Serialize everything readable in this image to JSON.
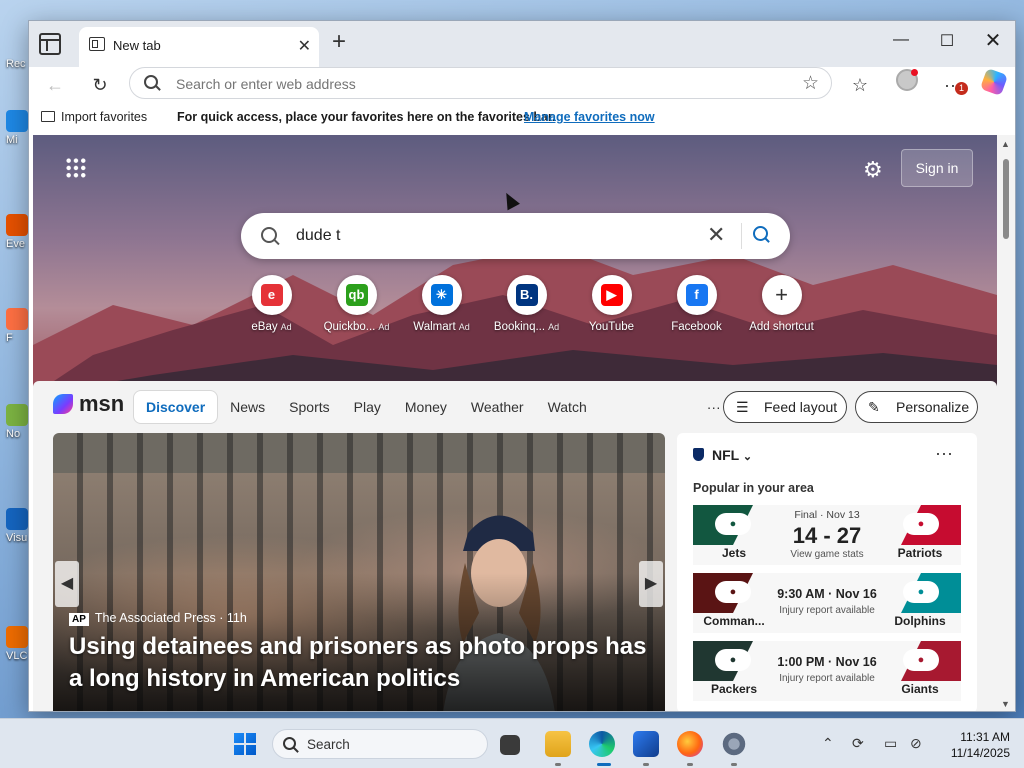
{
  "desktop": {
    "icons": [
      "Rec",
      "Mi",
      "Eve",
      "F",
      "No",
      "Visu",
      "VLC"
    ]
  },
  "browser": {
    "tab_title": "New tab",
    "address_placeholder": "Search or enter web address",
    "notification_count": "1",
    "favorites_bar": {
      "import_label": "Import favorites",
      "message": "For quick access, place your favorites here on the favorites bar.",
      "manage_link": "Manage favorites now"
    }
  },
  "newtab": {
    "signin_label": "Sign in",
    "search_value": "dude t",
    "shortcuts": [
      {
        "label": "eBay",
        "ad": "Ad",
        "color": "#e53238",
        "glyph": "e"
      },
      {
        "label": "Quickbo...",
        "ad": "Ad",
        "color": "#2ca01c",
        "glyph": "qb"
      },
      {
        "label": "Walmart",
        "ad": "Ad",
        "color": "#0071dc",
        "glyph": "✳"
      },
      {
        "label": "Bookinq...",
        "ad": "Ad",
        "color": "#003580",
        "glyph": "B."
      },
      {
        "label": "YouTube",
        "ad": "",
        "color": "#ff0000",
        "glyph": "▶"
      },
      {
        "label": "Facebook",
        "ad": "",
        "color": "#1877f2",
        "glyph": "f"
      },
      {
        "label": "Add shortcut",
        "ad": "",
        "color": "#ffffff",
        "glyph": "+"
      }
    ]
  },
  "msn": {
    "logo_text": "msn",
    "nav": [
      "Discover",
      "News",
      "Sports",
      "Play",
      "Money",
      "Weather",
      "Watch"
    ],
    "more": "···",
    "feed_layout_label": "Feed layout",
    "personalize_label": "Personalize",
    "hero": {
      "source_badge": "AP",
      "source": "The Associated Press · 11h",
      "headline": "Using detainees and prisoners as photo props has a long history in American politics"
    },
    "nfl": {
      "title": "NFL",
      "subtitle": "Popular in your area",
      "more": "···",
      "games": [
        {
          "status": "Final · Nov 13",
          "main": "14 - 27",
          "note": "View game stats",
          "left": "Jets",
          "right": "Patriots",
          "left_color": "#125740",
          "right_color": "#c60c30"
        },
        {
          "status": "",
          "main": "9:30 AM · Nov 16",
          "note": "Injury report available",
          "left": "Comman...",
          "right": "Dolphins",
          "left_color": "#5a1414",
          "right_color": "#008e97"
        },
        {
          "status": "",
          "main": "1:00 PM · Nov 16",
          "note": "Injury report available",
          "left": "Packers",
          "right": "Giants",
          "left_color": "#203731",
          "right_color": "#a71930"
        }
      ]
    }
  },
  "taskbar": {
    "search_label": "Search",
    "time": "11:31 AM",
    "date": "11/14/2025"
  }
}
